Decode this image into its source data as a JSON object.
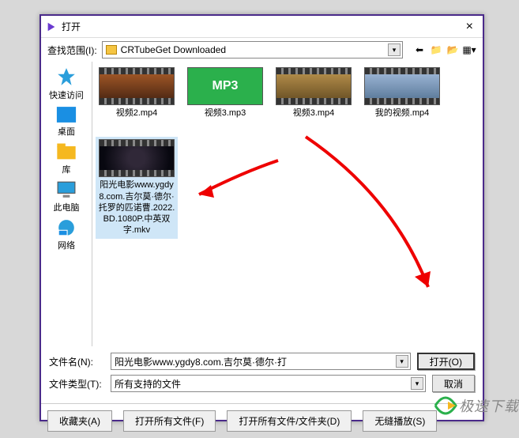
{
  "window": {
    "title": "打开",
    "close": "×"
  },
  "lookup": {
    "label": "查找范围(I):",
    "value": "CRTubeGet Downloaded"
  },
  "sidebar": {
    "items": [
      {
        "label": "快速访问"
      },
      {
        "label": "桌面"
      },
      {
        "label": "库"
      },
      {
        "label": "此电脑"
      },
      {
        "label": "网络"
      }
    ]
  },
  "files": {
    "top_row": [
      {
        "name": "视频2.mp4",
        "kind": "video",
        "thumb_color": "#a05030"
      },
      {
        "name": "视频3.mp3",
        "kind": "mp3"
      },
      {
        "name": "视频3.mp4",
        "kind": "video",
        "thumb_color": "#b08848"
      },
      {
        "name": "我的视频.mp4",
        "kind": "video",
        "thumb_color": "#9fb8d8"
      }
    ],
    "selected": {
      "name": "阳光电影www.ygdy8.com.吉尔莫·德尔·托罗的匹诺曹.2022.BD.1080P.中英双字.mkv",
      "kind": "video",
      "thumb_color": "#101018"
    }
  },
  "form": {
    "filename_label": "文件名(N):",
    "filename_value": "阳光电影www.ygdy8.com.吉尔莫·德尔·打",
    "type_label": "文件类型(T):",
    "type_value": "所有支持的文件",
    "open_btn": "打开(O)",
    "cancel_btn": "取消"
  },
  "footer": {
    "fav": "收藏夹(A)",
    "open_all_files": "打开所有文件(F)",
    "open_all_folders": "打开所有文件/文件夹(D)",
    "seamless": "无缝播放(S)"
  },
  "watermark": "极速下载"
}
